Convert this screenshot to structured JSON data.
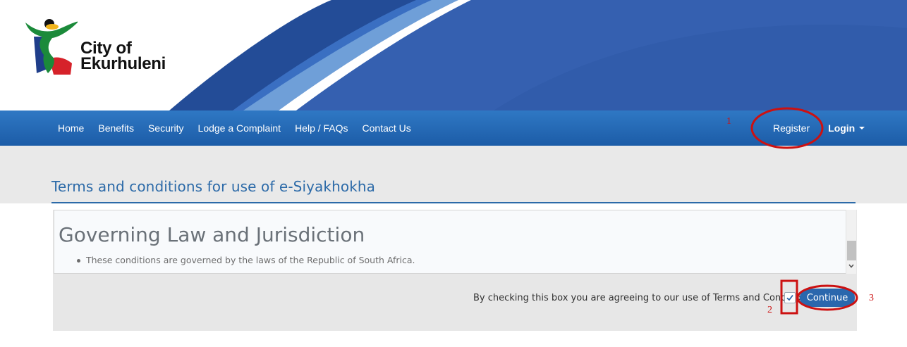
{
  "brand": {
    "logo_line1": "City of",
    "logo_line2": "Ekurhuleni",
    "colors": {
      "banner_blue": "#2f5fa8",
      "nav_blue": "#2467b3",
      "title_blue": "#2c6aa8",
      "annotation_red": "#cc1111"
    }
  },
  "nav": {
    "items": [
      "Home",
      "Benefits",
      "Security",
      "Lodge a Complaint",
      "Help / FAQs",
      "Contact Us"
    ],
    "register_label": "Register",
    "login_label": "Login"
  },
  "page": {
    "title": "Terms and conditions for use of e-Siyakhokha"
  },
  "terms": {
    "heading": "Governing Law and Jurisdiction",
    "bullet": "These conditions are governed by the laws of the Republic of South Africa."
  },
  "agreement": {
    "text": "By checking this box you are agreeing to our use of Terms and Conditions",
    "checked": true,
    "continue_label": "Continue"
  },
  "annotations": {
    "step1": "1",
    "step2": "2",
    "step3": "3"
  }
}
